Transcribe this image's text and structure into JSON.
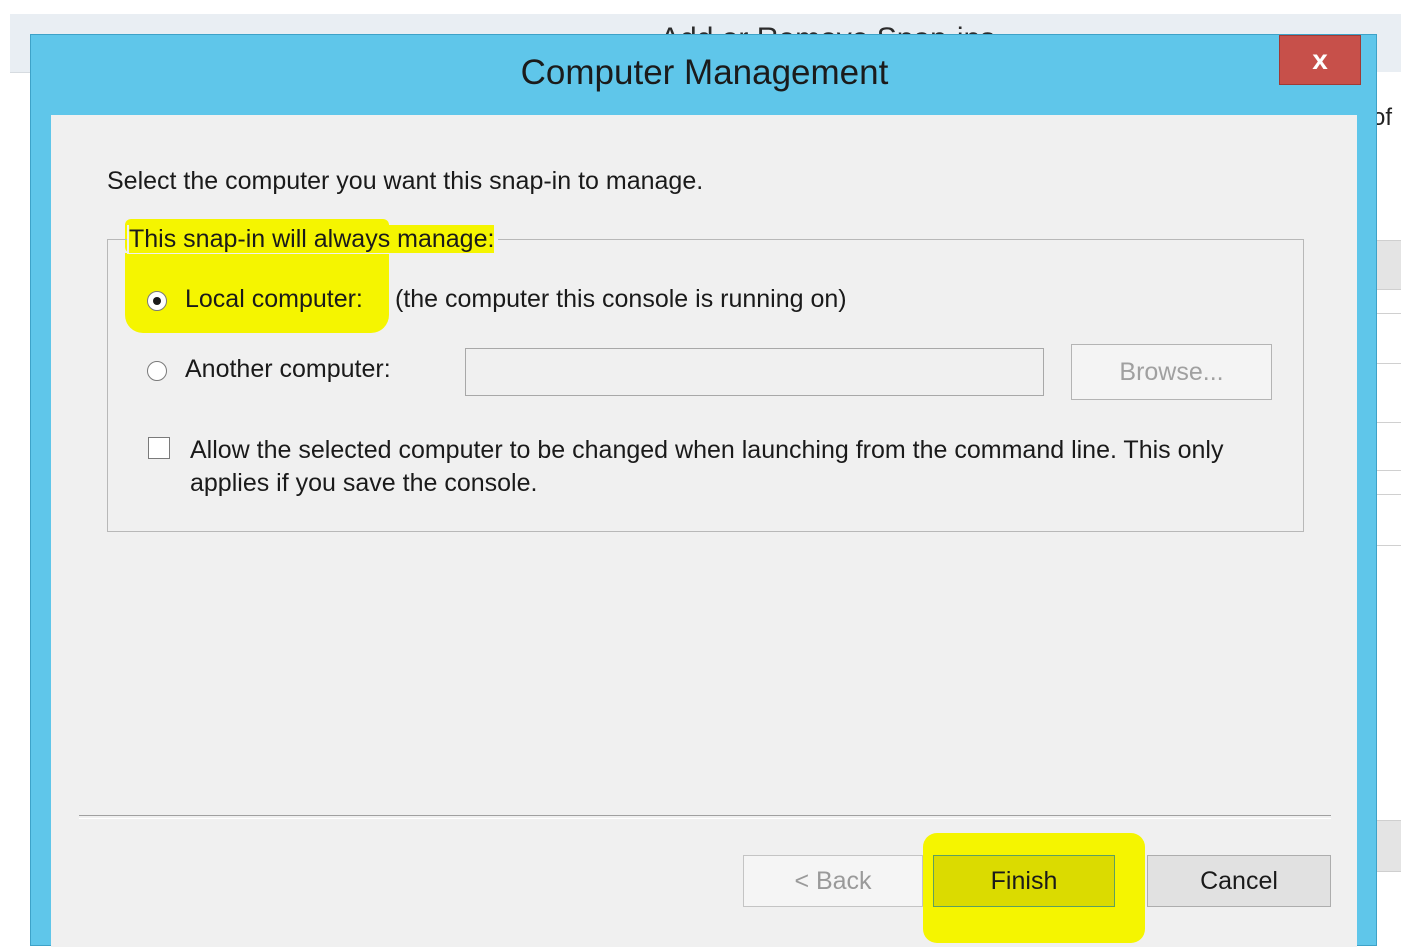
{
  "background_window": {
    "title": "Add or Remove Snap-ins",
    "partial_text": "of"
  },
  "dialog": {
    "title": "Computer Management",
    "close_label": "x",
    "intro": "Select the computer you want this snap-in to manage.",
    "group_label": "This snap-in will always manage:",
    "local_option": {
      "label": "Local computer:",
      "description": "(the computer this console is running on)",
      "selected": true
    },
    "another_option": {
      "label": "Another computer:",
      "value": "",
      "selected": false
    },
    "browse_label": "Browse...",
    "checkbox": {
      "label": "Allow the selected computer to be changed when launching from the command line.  This only applies if you save the console.",
      "checked": false
    },
    "buttons": {
      "back": "< Back",
      "finish": "Finish",
      "cancel": "Cancel"
    }
  },
  "colors": {
    "titlebar": "#5fc6ea",
    "close": "#c7504a",
    "highlight": "#f5f500"
  }
}
